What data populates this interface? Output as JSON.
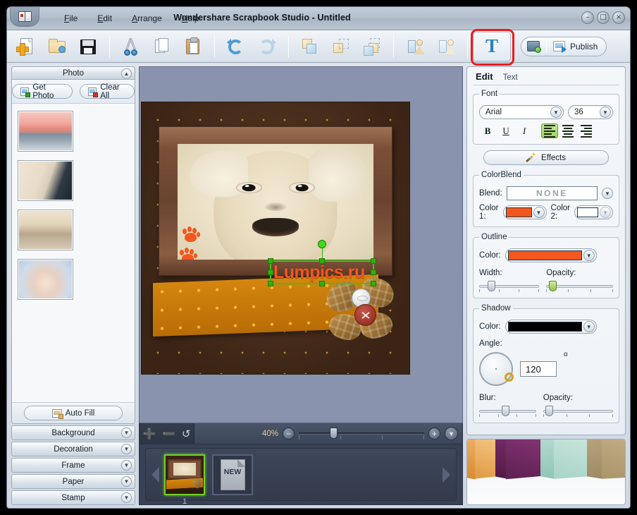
{
  "window": {
    "title": "Wondershare Scrapbook Studio - Untitled",
    "app_icon": "book-icon",
    "minimize": "–",
    "maximize": "□",
    "close": "×"
  },
  "menu": {
    "items": [
      {
        "label": "File",
        "mnemonic": "F"
      },
      {
        "label": "Edit",
        "mnemonic": "E"
      },
      {
        "label": "Arrange",
        "mnemonic": "A"
      },
      {
        "label": "Help",
        "mnemonic": "H"
      }
    ]
  },
  "toolbar": {
    "buttons": [
      {
        "name": "new-page-icon",
        "tooltip": "New"
      },
      {
        "name": "open-folder-icon",
        "tooltip": "Open"
      },
      {
        "name": "save-floppy-icon",
        "tooltip": "Save"
      },
      {
        "name": "cut-scissors-icon",
        "tooltip": "Cut"
      },
      {
        "name": "copy-icon",
        "tooltip": "Copy"
      },
      {
        "name": "paste-clipboard-icon",
        "tooltip": "Paste"
      },
      {
        "name": "undo-icon",
        "tooltip": "Undo"
      },
      {
        "name": "redo-icon",
        "tooltip": "Redo"
      },
      {
        "name": "bring-to-front-icon",
        "tooltip": "Bring to Front"
      },
      {
        "name": "send-backward-icon",
        "tooltip": "Send Backward"
      },
      {
        "name": "bring-forward-icon",
        "tooltip": "Bring Forward"
      },
      {
        "name": "send-to-back-icon",
        "tooltip": "Send to Back"
      },
      {
        "name": "align-person-left-icon",
        "tooltip": "Align"
      },
      {
        "name": "align-person-right-icon",
        "tooltip": "Align"
      }
    ],
    "text_tool_label": "T",
    "text_tool_highlight_color": "#ee1b1b",
    "slideshow_icon": "slideshow-icon",
    "publish_label": "Publish",
    "publish_icon": "publish-icon"
  },
  "left_panel": {
    "header": "Photo",
    "collapse_icon": "chevron-up-icon",
    "get_photo_label": "Get Photo",
    "clear_all_label": "Clear All",
    "photos": [
      {
        "name": "photo-sunset-couple"
      },
      {
        "name": "photo-bouquet"
      },
      {
        "name": "photo-beach-couple"
      },
      {
        "name": "photo-baby-hat"
      }
    ],
    "auto_fill_label": "Auto Fill",
    "sections": [
      {
        "label": "Background",
        "icon": "chevron-down-icon"
      },
      {
        "label": "Decoration",
        "icon": "chevron-down-icon"
      },
      {
        "label": "Frame",
        "icon": "chevron-down-icon"
      },
      {
        "label": "Paper",
        "icon": "chevron-down-icon"
      },
      {
        "label": "Stamp",
        "icon": "chevron-down-icon"
      }
    ]
  },
  "canvas": {
    "text_object": {
      "value": "Lumpics.ru",
      "color": "#f2571f",
      "selected": true,
      "rotate_handle": "rotate-handle"
    },
    "zoom": {
      "add_icon": "plus-icon",
      "remove_icon": "minus-icon",
      "reset_icon": "undo-icon",
      "percent": "40%",
      "zoom_out_icon": "minus-circle-icon",
      "zoom_in_icon": "plus-circle-icon",
      "expand_icon": "chevron-down-icon"
    },
    "filmstrip": {
      "prev_icon": "arrow-left-icon",
      "next_icon": "arrow-right-icon",
      "slides": [
        {
          "label": "1",
          "selected": true,
          "type": "page"
        },
        {
          "label": "NEW",
          "selected": false,
          "type": "new"
        }
      ]
    }
  },
  "right_panel": {
    "tabs": [
      {
        "label": "Edit",
        "active": true
      },
      {
        "label": "Text",
        "active": false
      }
    ],
    "font": {
      "legend": "Font",
      "family": "Arial",
      "size": "36",
      "bold": "B",
      "underline": "U",
      "italic": "I",
      "align_left": "align-left",
      "align_center": "align-center",
      "align_right": "align-right",
      "active_align": "align-left"
    },
    "effects_label": "Effects",
    "colorblend": {
      "legend": "ColorBlend",
      "blend_label": "Blend:",
      "blend_value": "NONE",
      "color1_label": "Color 1:",
      "color1_value": "#f2571f",
      "color2_label": "Color 2:",
      "color2_value": "#ffffff"
    },
    "outline": {
      "legend": "Outline",
      "color_label": "Color:",
      "color_value": "#f2571f",
      "width_label": "Width:",
      "width_pct": 14,
      "opacity_label": "Opacity:",
      "opacity_pct": 4
    },
    "shadow": {
      "legend": "Shadow",
      "color_label": "Color:",
      "color_value": "#000000",
      "angle_label": "Angle:",
      "angle_value": "120",
      "angle_unit": "o",
      "blur_label": "Blur:",
      "blur_pct": 40,
      "opacity_label": "Opacity:",
      "opacity_pct": 3
    },
    "preview_name": "template-gallery-preview"
  }
}
